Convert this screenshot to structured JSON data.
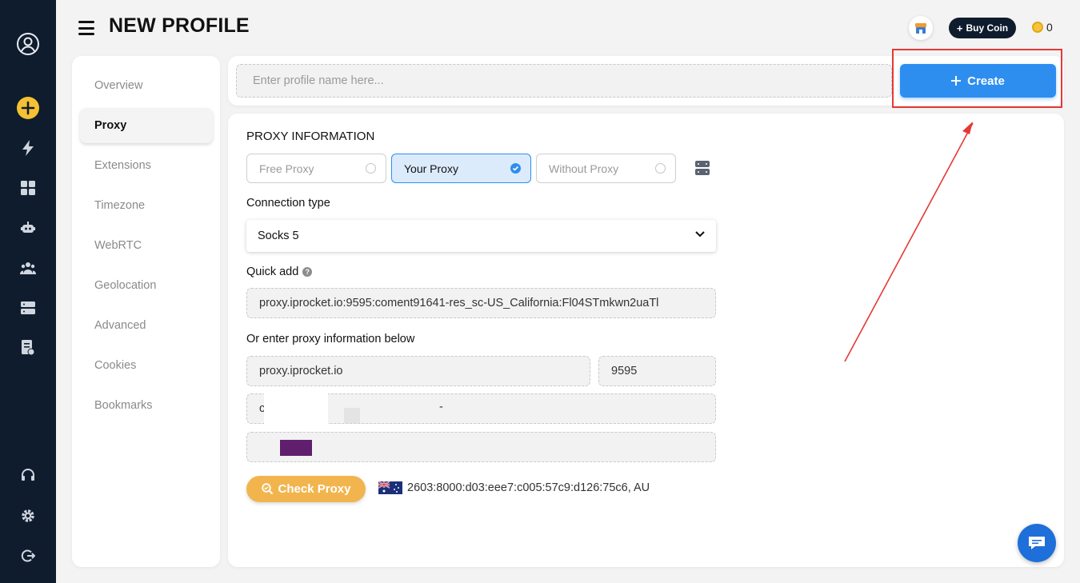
{
  "header": {
    "title": "NEW PROFILE",
    "buy_coin_label": "Buy Coin",
    "coin_count": "0"
  },
  "sidebar": {
    "items": [
      {
        "label": "Overview",
        "active": false
      },
      {
        "label": "Proxy",
        "active": true
      },
      {
        "label": "Extensions",
        "active": false
      },
      {
        "label": "Timezone",
        "active": false
      },
      {
        "label": "WebRTC",
        "active": false
      },
      {
        "label": "Geolocation",
        "active": false
      },
      {
        "label": "Advanced",
        "active": false
      },
      {
        "label": "Cookies",
        "active": false
      },
      {
        "label": "Bookmarks",
        "active": false
      }
    ]
  },
  "profile": {
    "name_placeholder": "Enter profile name here...",
    "create_label": "Create"
  },
  "proxy": {
    "section_title": "PROXY INFORMATION",
    "options": [
      {
        "label": "Free Proxy",
        "selected": false
      },
      {
        "label": "Your Proxy",
        "selected": true
      },
      {
        "label": "Without Proxy",
        "selected": false
      }
    ],
    "connection_type_label": "Connection type",
    "connection_type_value": "Socks 5",
    "quick_add_label": "Quick add",
    "quick_add_value": "proxy.iprocket.io:9595:coment91641-res_sc-US_California:Fl04STmkwn2uaTl",
    "manual_label": "Or enter proxy information below",
    "host_value": "proxy.iprocket.io",
    "port_value": "9595",
    "username_value_start": "c",
    "username_value_mid": "-",
    "check_label": "Check Proxy",
    "check_result": "2603:8000:d03:eee7:c005:57c9:d126:75c6, AU"
  },
  "colors": {
    "rail": "#0f1c2d",
    "accent_blue": "#2d8ef0",
    "check_orange": "#f2b54e",
    "highlight_red": "#e53935"
  }
}
